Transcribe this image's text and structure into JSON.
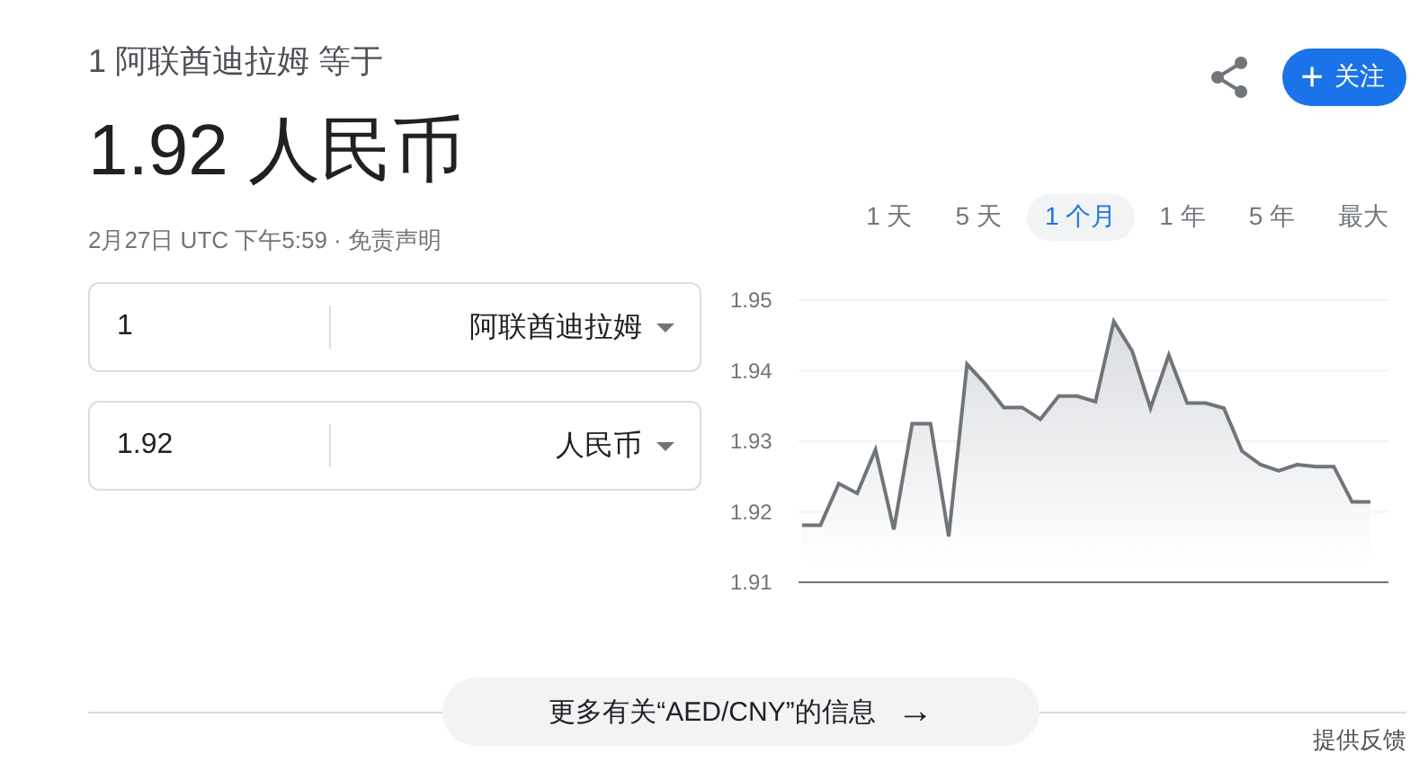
{
  "header": {
    "subtitle": "1 阿联酋迪拉姆 等于",
    "result": "1.92 人民币",
    "timestamp": "2月27日 UTC 下午5:59",
    "separator": "·",
    "disclaimer": "免责声明"
  },
  "actions": {
    "follow_icon": "+",
    "follow": "关注"
  },
  "converter": [
    {
      "amount": "1",
      "currency": "阿联酋迪拉姆"
    },
    {
      "amount": "1.92",
      "currency": "人民币"
    }
  ],
  "ranges": [
    {
      "label": "1 天",
      "selected": false
    },
    {
      "label": "5 天",
      "selected": false
    },
    {
      "label": "1 个月",
      "selected": true
    },
    {
      "label": "1 年",
      "selected": false
    },
    {
      "label": "5 年",
      "selected": false
    },
    {
      "label": "最大",
      "selected": false
    }
  ],
  "chart_data": {
    "type": "area",
    "grid": true,
    "ylim": [
      1.91,
      1.95
    ],
    "yticks": [
      1.91,
      1.92,
      1.93,
      1.94,
      1.95
    ],
    "series": [
      {
        "color": "#70757a",
        "values": [
          1.9181,
          1.9181,
          1.924,
          1.9226,
          1.9288,
          1.9175,
          1.9325,
          1.9325,
          1.9165,
          1.9409,
          1.9381,
          1.9348,
          1.9348,
          1.9331,
          1.9364,
          1.9364,
          1.9356,
          1.947,
          1.9428,
          1.9347,
          1.9422,
          1.9354,
          1.9354,
          1.9347,
          1.9286,
          1.9267,
          1.9258,
          1.9267,
          1.9264,
          1.9264,
          1.9214,
          1.9214
        ]
      }
    ]
  },
  "more_info": "更多有关“AED/CNY”的信息",
  "more_icon": "→",
  "feedback": "提供反馈"
}
